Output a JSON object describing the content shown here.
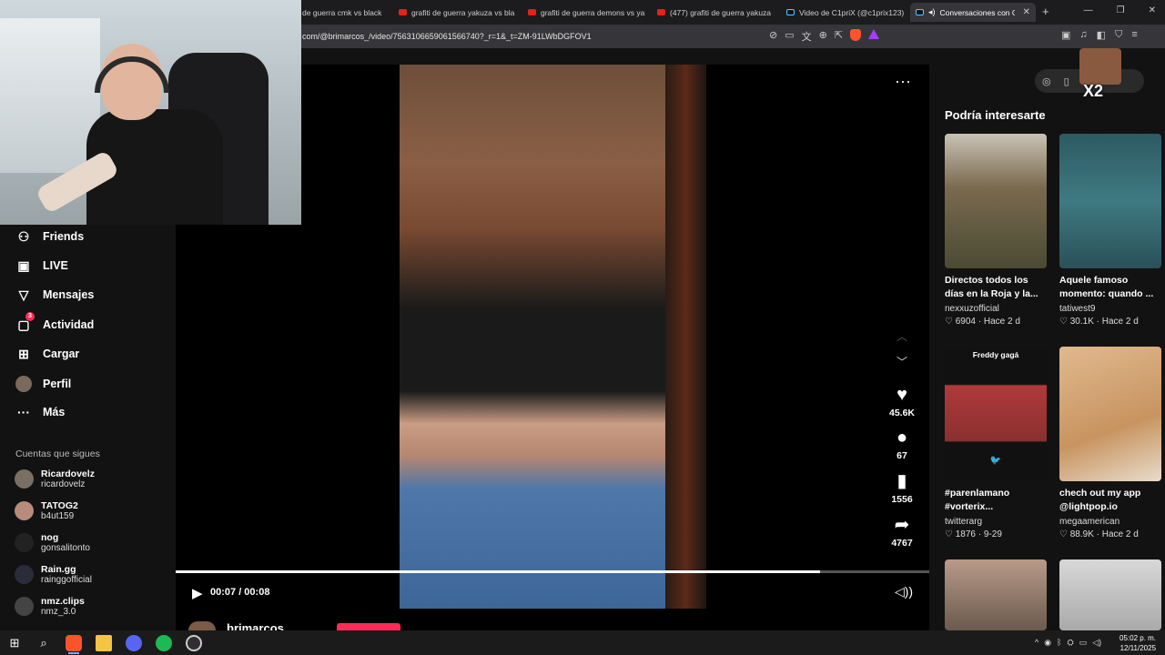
{
  "browser": {
    "tabs": [
      {
        "label": "de guerra cmk vs black",
        "icon": "youtube-icon"
      },
      {
        "label": "grafiti de guerra yakuza vs bla",
        "icon": "youtube-icon"
      },
      {
        "label": "grafiti de guerra demons vs ya",
        "icon": "youtube-icon"
      },
      {
        "label": "(477) grafiti de guerra yakuza",
        "icon": "youtube-icon"
      },
      {
        "label": "Video de C1priX (@c1prix123)",
        "icon": "tiktok-icon"
      },
      {
        "label": "Conversaciones con Gil",
        "icon": "tiktok-icon",
        "active": true
      }
    ],
    "new_tab": "+",
    "url": "com/@brimarcos_/video/7563106659061566740?_r=1&_t=ZM-91LWbDGFOV1"
  },
  "sidebar": {
    "items": [
      {
        "label": "Friends",
        "icon": "friends-icon",
        "glyph": "⚇"
      },
      {
        "label": "LIVE",
        "icon": "live-icon",
        "glyph": "▣"
      },
      {
        "label": "Mensajes",
        "icon": "messages-icon",
        "glyph": "▽"
      },
      {
        "label": "Actividad",
        "icon": "activity-icon",
        "glyph": "▢",
        "badge": "3"
      },
      {
        "label": "Cargar",
        "icon": "upload-icon",
        "glyph": "⊞"
      },
      {
        "label": "Perfil",
        "icon": "profile-avatar",
        "glyph": ""
      },
      {
        "label": "Más",
        "icon": "more-icon",
        "glyph": "···"
      }
    ],
    "following_title": "Cuentas que sigues",
    "following": [
      {
        "name": "Ricardovelz",
        "handle": "ricardovelz"
      },
      {
        "name": "TATOG2",
        "handle": "b4ut159"
      },
      {
        "name": "nog",
        "handle": "gonsalitonto"
      },
      {
        "name": "Rain.gg",
        "handle": "rainggofficial"
      },
      {
        "name": "nmz.clips",
        "handle": "nmz_3.0"
      }
    ]
  },
  "video": {
    "time": "00:07 / 00:08",
    "progress": 0.855,
    "author": "brimarcos_",
    "actions": [
      {
        "name": "like",
        "glyph": "♥",
        "count": "45.6K"
      },
      {
        "name": "comment",
        "glyph": "💬",
        "count": "67"
      },
      {
        "name": "bookmark",
        "glyph": "🔖",
        "count": "1556"
      },
      {
        "name": "share",
        "glyph": "➦",
        "count": "4767"
      }
    ]
  },
  "recommended": {
    "title": "Podría interesarte",
    "cards": [
      {
        "title": "Directos todos los días en la Roja y la...",
        "user": "nexxuzofficial",
        "meta": "♡ 6904 · Hace 2 d",
        "color": "#6b5a3e"
      },
      {
        "title": "Aquele famoso momento: quando ...",
        "user": "tatiwest9",
        "meta": "♡ 30.1K · Hace 2 d",
        "color": "#3e6a72"
      },
      {
        "title": "#parenlamano #vorterix...",
        "user": "twitterarg",
        "meta": "♡ 1876 · 9-29",
        "color": "#8a3a3a",
        "overlay": "Freddy gagá"
      },
      {
        "title": "chech out my app @lightpop.io",
        "user": "megaamerican",
        "meta": "♡ 88.9K · Hace 2 d",
        "color": "#d6a77a"
      },
      {
        "title": "",
        "user": "",
        "meta": "",
        "color": "#7a6a5e"
      },
      {
        "title": "",
        "user": "",
        "meta": "",
        "color": "#c9c9c9"
      }
    ]
  },
  "overlay": {
    "x2": "X2"
  },
  "taskbar": {
    "clock_time": "05:02 p. m.",
    "clock_date": "12/11/2025"
  }
}
